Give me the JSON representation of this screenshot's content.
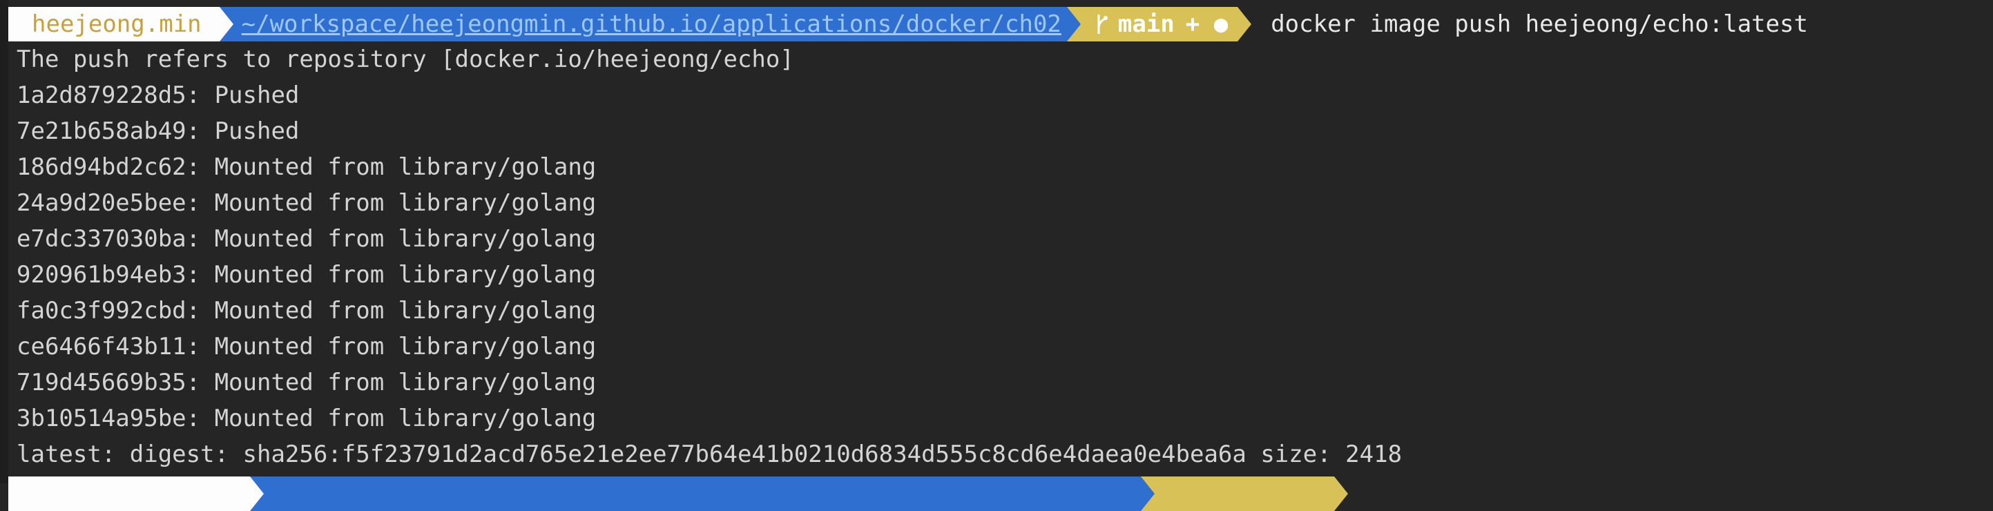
{
  "prompt": {
    "user": "heejeong.min",
    "path": "~/workspace/heejeongmin.github.io/applications/docker/ch02",
    "branch": "main",
    "git_status": "+ ●",
    "branch_icon": "git-branch-icon",
    "command": "docker image push heejeong/echo:latest"
  },
  "output": [
    "The push refers to repository [docker.io/heejeong/echo]",
    "1a2d879228d5: Pushed",
    "7e21b658ab49: Pushed",
    "186d94bd2c62: Mounted from library/golang",
    "24a9d20e5bee: Mounted from library/golang",
    "e7dc337030ba: Mounted from library/golang",
    "920961b94eb3: Mounted from library/golang",
    "fa0c3f992cbd: Mounted from library/golang",
    "ce6466f43b11: Mounted from library/golang",
    "719d45669b35: Mounted from library/golang",
    "3b10514a95be: Mounted from library/golang",
    "latest: digest: sha256:f5f23791d2acd765e21e2ee77b64e41b0210d6834d555c8cd6e4daea0e4bea6a size: 2418"
  ],
  "colors": {
    "background": "#252526",
    "user_segment": "#fdfdfd",
    "path_segment": "#2f6fd0",
    "git_segment": "#d8c257"
  }
}
